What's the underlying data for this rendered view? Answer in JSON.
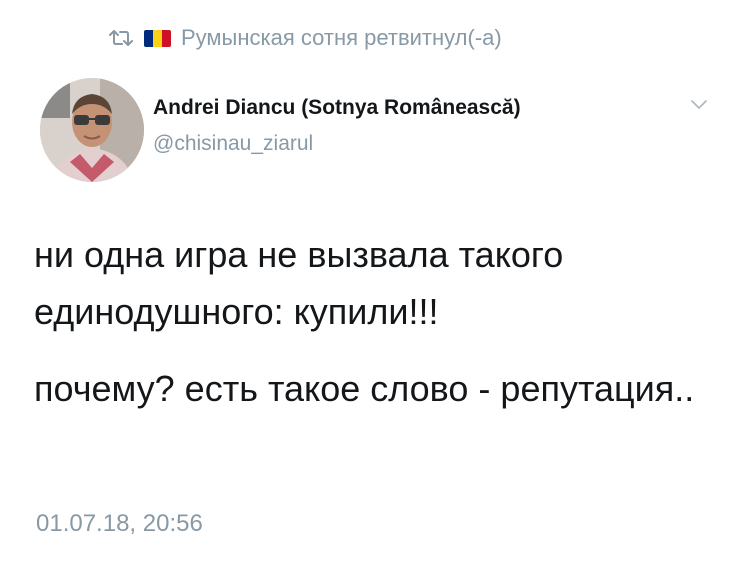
{
  "retweet": {
    "icon": "retweet-icon",
    "flag_colors": [
      "#002b7f",
      "#fcd116",
      "#ce1126"
    ],
    "text": "Румынская сотня ретвитнул(-а)"
  },
  "author": {
    "display_name": "Andrei Diancu (Sotnya Românească)",
    "username": "@chisinau_ziarul",
    "menu_icon": "chevron-down-icon"
  },
  "tweet": {
    "paragraphs": [
      "ни одна игра не вызвала такого единодушного: купили!!!",
      "почему? есть такое слово - репутация.."
    ],
    "timestamp": "01.07.18, 20:56"
  },
  "colors": {
    "text": "#14171a",
    "secondary": "#8899a6"
  }
}
